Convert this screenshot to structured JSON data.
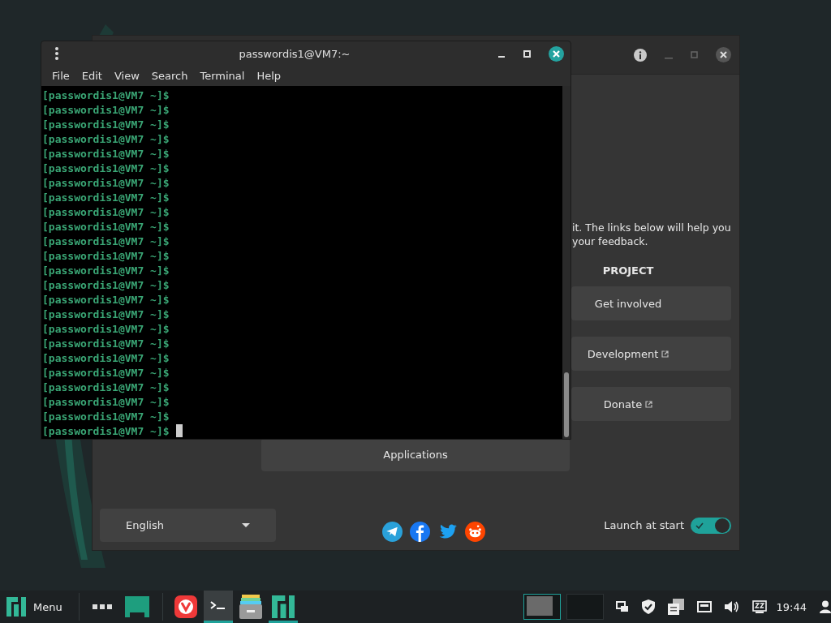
{
  "welcome_window": {
    "intro_lines": [
      "it. The links below will help you",
      "your feedback."
    ],
    "section_heading": "PROJECT",
    "project_buttons": [
      {
        "label": "Get involved",
        "external": false
      },
      {
        "label": "Development",
        "external": true
      },
      {
        "label": "Donate",
        "external": true
      }
    ],
    "applications_button": "Applications",
    "language": {
      "value": "English"
    },
    "social_links": [
      {
        "kind": "telegram"
      },
      {
        "kind": "facebook"
      },
      {
        "kind": "twitter"
      },
      {
        "kind": "reddit"
      }
    ],
    "launch_at_start": {
      "label": "Launch at start",
      "on": true
    }
  },
  "terminal": {
    "title": "passwordis1@VM7:~",
    "menu": [
      "File",
      "Edit",
      "View",
      "Search",
      "Terminal",
      "Help"
    ],
    "lines": [
      "[passwordis1@VM7 ~]$",
      "[passwordis1@VM7 ~]$",
      "[passwordis1@VM7 ~]$",
      "[passwordis1@VM7 ~]$",
      "[passwordis1@VM7 ~]$",
      "[passwordis1@VM7 ~]$",
      "[passwordis1@VM7 ~]$",
      "[passwordis1@VM7 ~]$",
      "[passwordis1@VM7 ~]$",
      "[passwordis1@VM7 ~]$",
      "[passwordis1@VM7 ~]$",
      "[passwordis1@VM7 ~]$",
      "[passwordis1@VM7 ~]$",
      "[passwordis1@VM7 ~]$",
      "[passwordis1@VM7 ~]$",
      "[passwordis1@VM7 ~]$",
      "[passwordis1@VM7 ~]$",
      "[passwordis1@VM7 ~]$",
      "[passwordis1@VM7 ~]$",
      "[passwordis1@VM7 ~]$",
      "[passwordis1@VM7 ~]$",
      "[passwordis1@VM7 ~]$",
      "[passwordis1@VM7 ~]$",
      "[passwordis1@VM7 ~]$"
    ]
  },
  "taskbar": {
    "menu_label": "Menu",
    "launchers": [
      {
        "kind": "vivaldi",
        "selected": false
      },
      {
        "kind": "terminal",
        "selected": true
      },
      {
        "kind": "files",
        "selected": false
      },
      {
        "kind": "welcome",
        "selected": true
      }
    ],
    "workspaces": [
      {
        "selected": true
      },
      {
        "selected": false
      }
    ],
    "clock": "19:44"
  }
}
